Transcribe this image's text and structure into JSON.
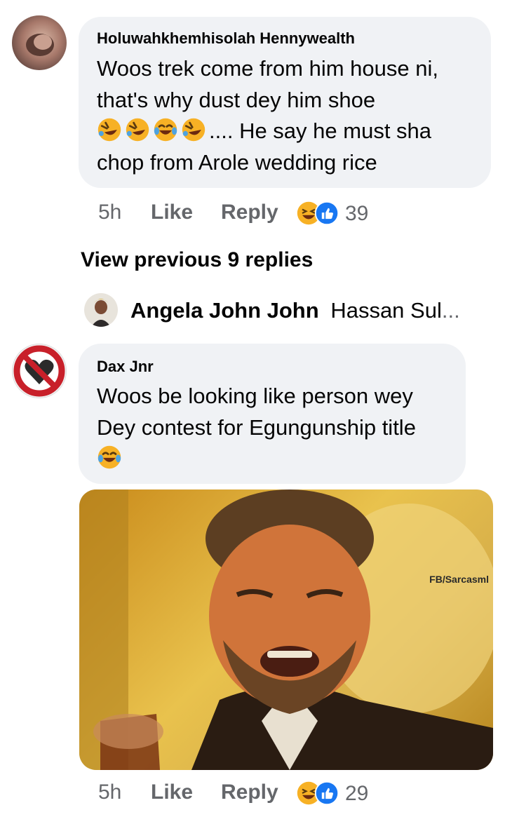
{
  "comments": [
    {
      "author": "Holuwahkhemhisolah Hennywealth",
      "lines": [
        "Woos trek come from him house ni,",
        "that's why dust dey him shoe"
      ],
      "line3_suffix": ".... He say he must sha",
      "line4": "chop from Arole wedding rice",
      "emojis": [
        "rolling-on-floor-laughing",
        "rolling-on-floor-laughing",
        "tears-of-joy",
        "rolling-on-floor-laughing"
      ],
      "time": "5h",
      "like": "Like",
      "reply": "Reply",
      "reaction_count": "39",
      "reactions": [
        "haha",
        "like"
      ]
    },
    {
      "author": "Dax Jnr",
      "lines": [
        "Woos be looking like person wey",
        "Dey contest for Egungunship title"
      ],
      "emojis": [
        "tears-of-joy"
      ],
      "image_watermark": "FB/Sarcasml",
      "time": "5h",
      "like": "Like",
      "reply": "Reply",
      "reaction_count": "29",
      "reactions": [
        "haha",
        "like"
      ]
    }
  ],
  "view_previous": "View previous 9 replies",
  "preview_reply": {
    "author": "Angela John John",
    "text": "Hassan Sul",
    "ellipsis": "..."
  },
  "colors": {
    "bubble": "#f0f2f5",
    "meta": "#65676b",
    "like_blue": "#1877f2",
    "haha_yellow": "#f7b125"
  }
}
